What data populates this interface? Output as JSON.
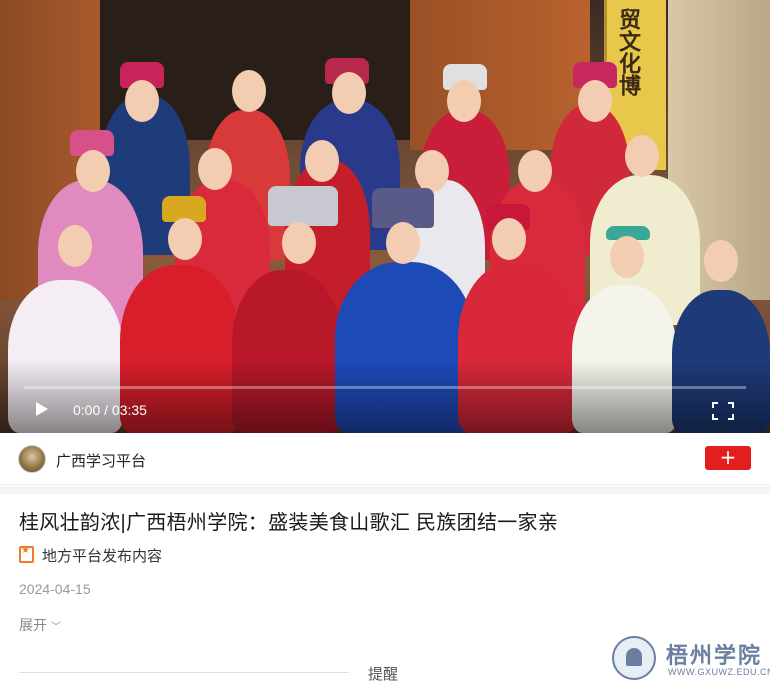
{
  "video": {
    "current_time": "0:00",
    "separator": " / ",
    "duration": "03:35",
    "progress": 0.0,
    "sign_text": "贸文化博"
  },
  "author": {
    "name": "广西学习平台",
    "follow_label": "+"
  },
  "article": {
    "title": "桂风壮韵浓|广西梧州学院：盛装美食山歌汇 民族团结一家亲",
    "source_label": "地方平台发布内容",
    "date": "2024-04-15",
    "expand_label": "展开",
    "reminder_label": "提醒"
  },
  "watermark": {
    "name": "梧州学院",
    "url": "WWW.GXUWZ.EDU.CN"
  },
  "colors": {
    "accent_red": "#e31e1e",
    "source_orange": "#f07a2a",
    "muted_gray": "#999999"
  },
  "icons": {
    "play": "play-icon",
    "fullscreen": "fullscreen-icon",
    "source": "badge-star-icon",
    "expand": "chevron-down-icon"
  }
}
